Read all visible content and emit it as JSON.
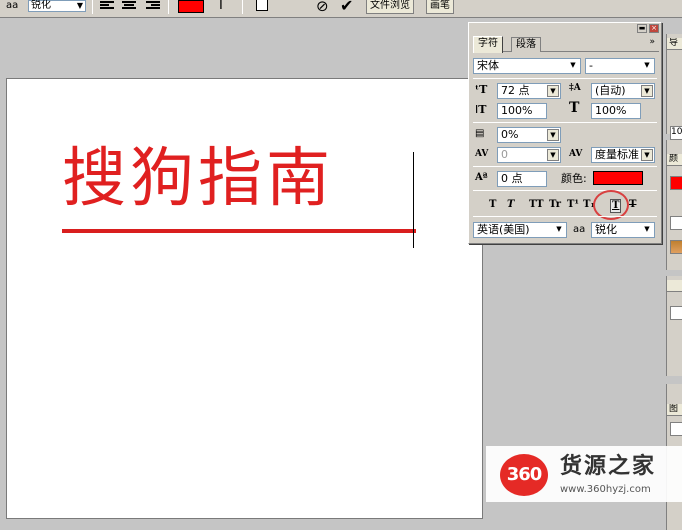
{
  "options_bar": {
    "aa_icon": "aa",
    "antialias_value": "锐化",
    "color": "#ff0000",
    "tabs": [
      "文件浏览",
      "画笔"
    ]
  },
  "canvas": {
    "text": "搜狗指南",
    "text_color": "#e02020"
  },
  "character_panel": {
    "tabs": [
      "字符",
      "段落"
    ],
    "active_tab": "字符",
    "font_family": "宋体",
    "font_style": "-",
    "font_size": "72 点",
    "leading": "(自动)",
    "vertical_scale": "100%",
    "horizontal_scale": "100%",
    "tsume": "0%",
    "kerning": "0",
    "tracking": "度量标准",
    "baseline_shift": "0 点",
    "color_label": "颜色:",
    "color": "#ff0000",
    "style_buttons": [
      "T",
      "T",
      "TT",
      "Tr",
      "T¹",
      "T₁",
      "T",
      "T"
    ],
    "language": "英语(美国)",
    "aa_icon": "aa",
    "antialias": "锐化"
  },
  "right_dock": {
    "items": [
      "导",
      "10",
      "颜",
      "图"
    ]
  },
  "watermark": {
    "logo": "360",
    "brand": "货源之家",
    "url": "www.360hyzj.com"
  }
}
